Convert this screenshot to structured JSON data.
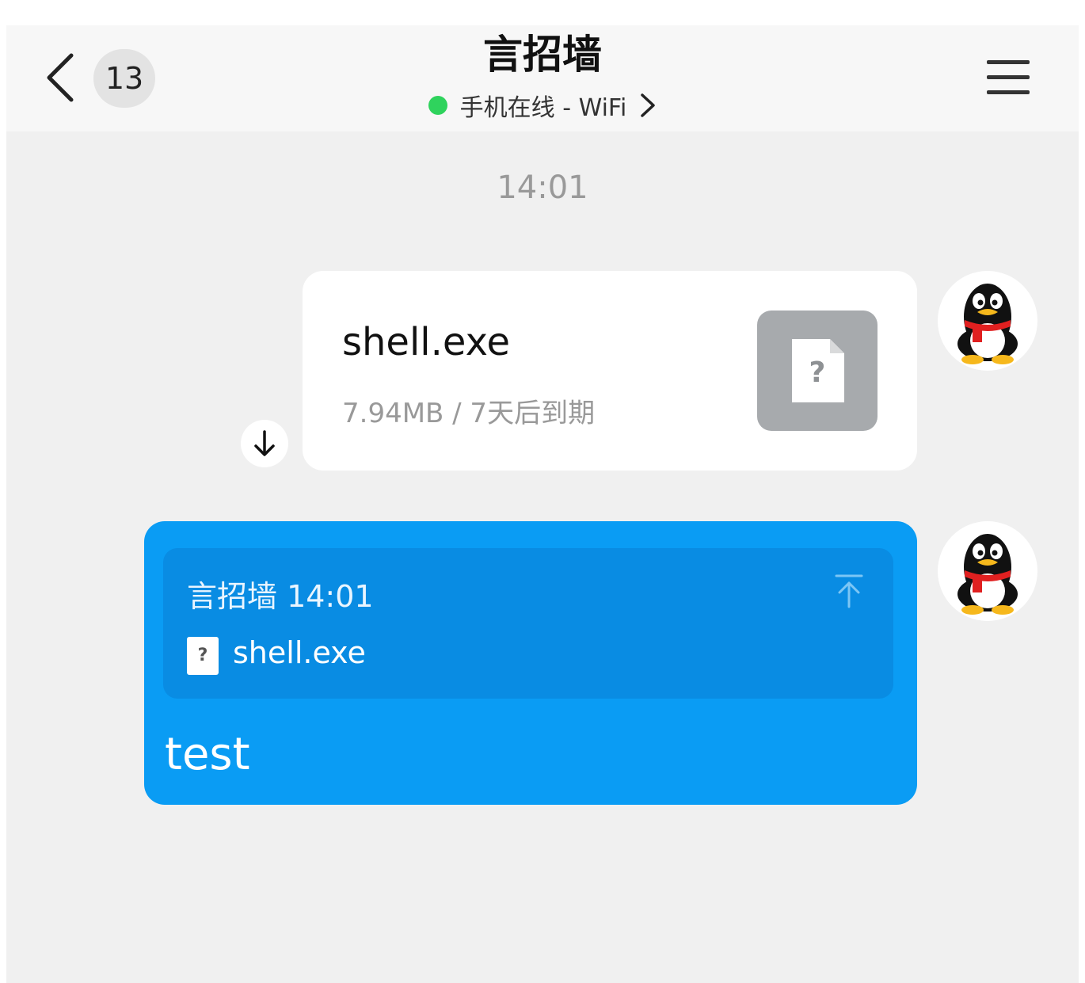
{
  "navbar": {
    "back_icon": "chevron-left-icon",
    "unread_count": "13",
    "title": "言招墙",
    "status": "手机在线 - WiFi",
    "status_color": "#2fd35d",
    "menu_icon": "hamburger-menu-icon"
  },
  "chat": {
    "timestamp": "14:01",
    "file_message": {
      "file_name": "shell.exe",
      "meta": "7.94MB / 7天后到期",
      "thumb_icon": "unknown-file-icon",
      "download_icon": "arrow-down-icon"
    },
    "reply_message": {
      "quote_header": "言招墙 14:01",
      "quote_file_icon_label": "?",
      "quote_file_name": "shell.exe",
      "text": "test",
      "bubble_color": "#0a9cf4"
    },
    "avatar_icon": "qq-penguin-icon"
  }
}
